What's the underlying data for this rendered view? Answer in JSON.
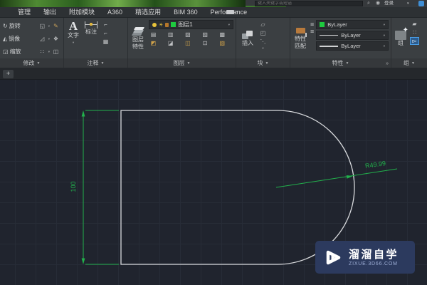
{
  "titlebar": {
    "search_placeholder": "键入关键字或短语",
    "signin_label": "登录"
  },
  "menu_tabs": [
    "管理",
    "输出",
    "附加模块",
    "A360",
    "精选应用",
    "BIM 360",
    "Performance"
  ],
  "ribbon": {
    "modify": {
      "label": "修改",
      "rotate": "旋转",
      "mirror": "镜像",
      "scale": "缩放"
    },
    "annotate": {
      "label": "注释",
      "text": "文字",
      "dimension": "标注"
    },
    "layers": {
      "label": "图层",
      "properties_line1": "图层",
      "properties_line2": "特性",
      "current_layer": "图层1"
    },
    "block": {
      "label": "块",
      "insert": "插入"
    },
    "properties": {
      "label": "特性",
      "match_line1": "特性",
      "match_line2": "匹配",
      "color_value": "ByLayer",
      "linetype_value": "ByLayer",
      "lineweight_value": "ByLayer"
    },
    "group": {
      "label": "组",
      "group_button": "组"
    }
  },
  "filetabs": {
    "new_tab": "+"
  },
  "canvas": {
    "height_dim": "100",
    "radius_dim": "R49.99"
  },
  "watermark": {
    "title": "溜溜自学",
    "url": "ZIXUE.3D66.COM"
  },
  "colors": {
    "dimension_green": "#22b14c",
    "geometry_white": "#d8dadd",
    "bylayer_swatch_green": "#1ecb3f",
    "watermark_bg": "#2c3a5e",
    "canvas_bg": "#20242e"
  }
}
